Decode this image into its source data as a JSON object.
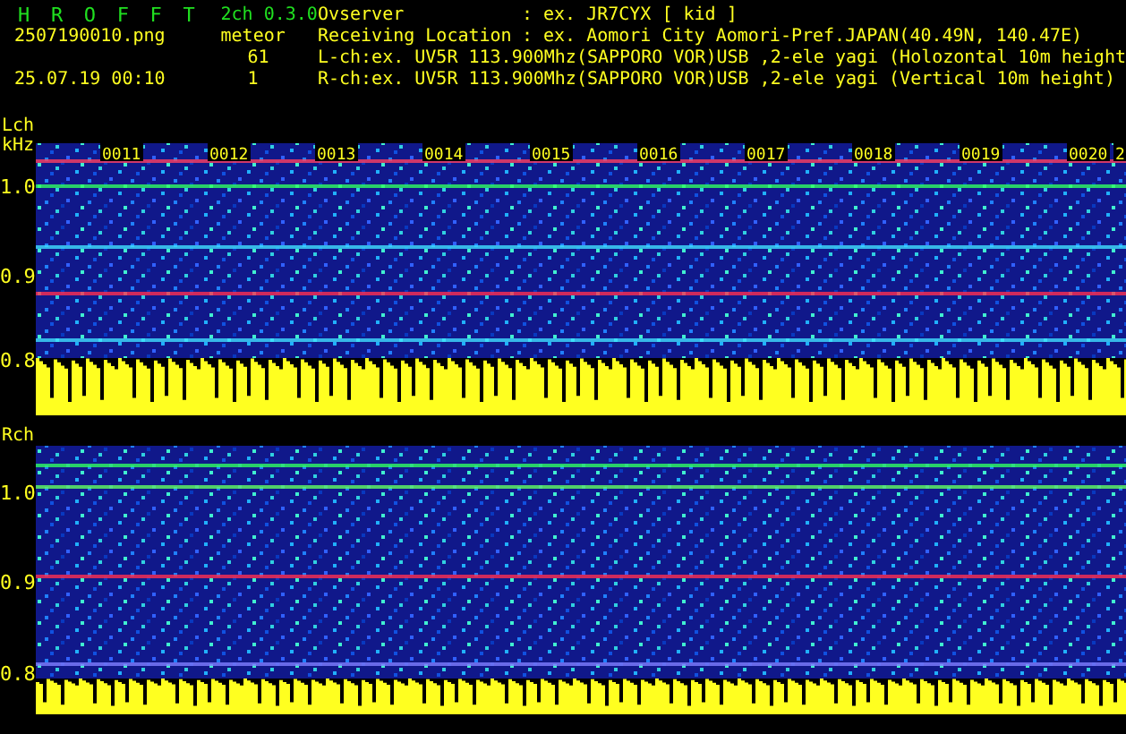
{
  "app": {
    "title": "H R O F F T",
    "version": "2ch 0.3.0",
    "filename": "2507190010.png",
    "timestamp": "25.07.19 00:10",
    "meteor_label": "meteor",
    "counts": [
      "61",
      "1"
    ]
  },
  "info": [
    {
      "label": "Ovserver",
      "value": ": ex. JR7CYX [ kid ]"
    },
    {
      "label": "Receiving Location",
      "value": ": ex. Aomori City Aomori-Pref.JAPAN(40.49N, 140.47E)"
    }
  ],
  "channels": [
    "L-ch:ex. UV5R 113.900Mhz(SAPPORO VOR)USB ,2-ele yagi (Holozontal 10m height",
    "R-ch:ex. UV5R 113.900Mhz(SAPPORO VOR)USB ,2-ele yagi (Vertical 10m height)"
  ],
  "panels": [
    {
      "label": "Lch",
      "unit": "kHz",
      "yticks": [
        "1.0",
        "0.9",
        "0.8"
      ],
      "time_labels": [
        "0011",
        "0012",
        "0013",
        "0014",
        "0015",
        "0016",
        "0017",
        "0018",
        "0019",
        "0020",
        "2"
      ]
    },
    {
      "label": "Rch",
      "yticks": [
        "1.0",
        "0.9",
        "0.8"
      ]
    }
  ]
}
